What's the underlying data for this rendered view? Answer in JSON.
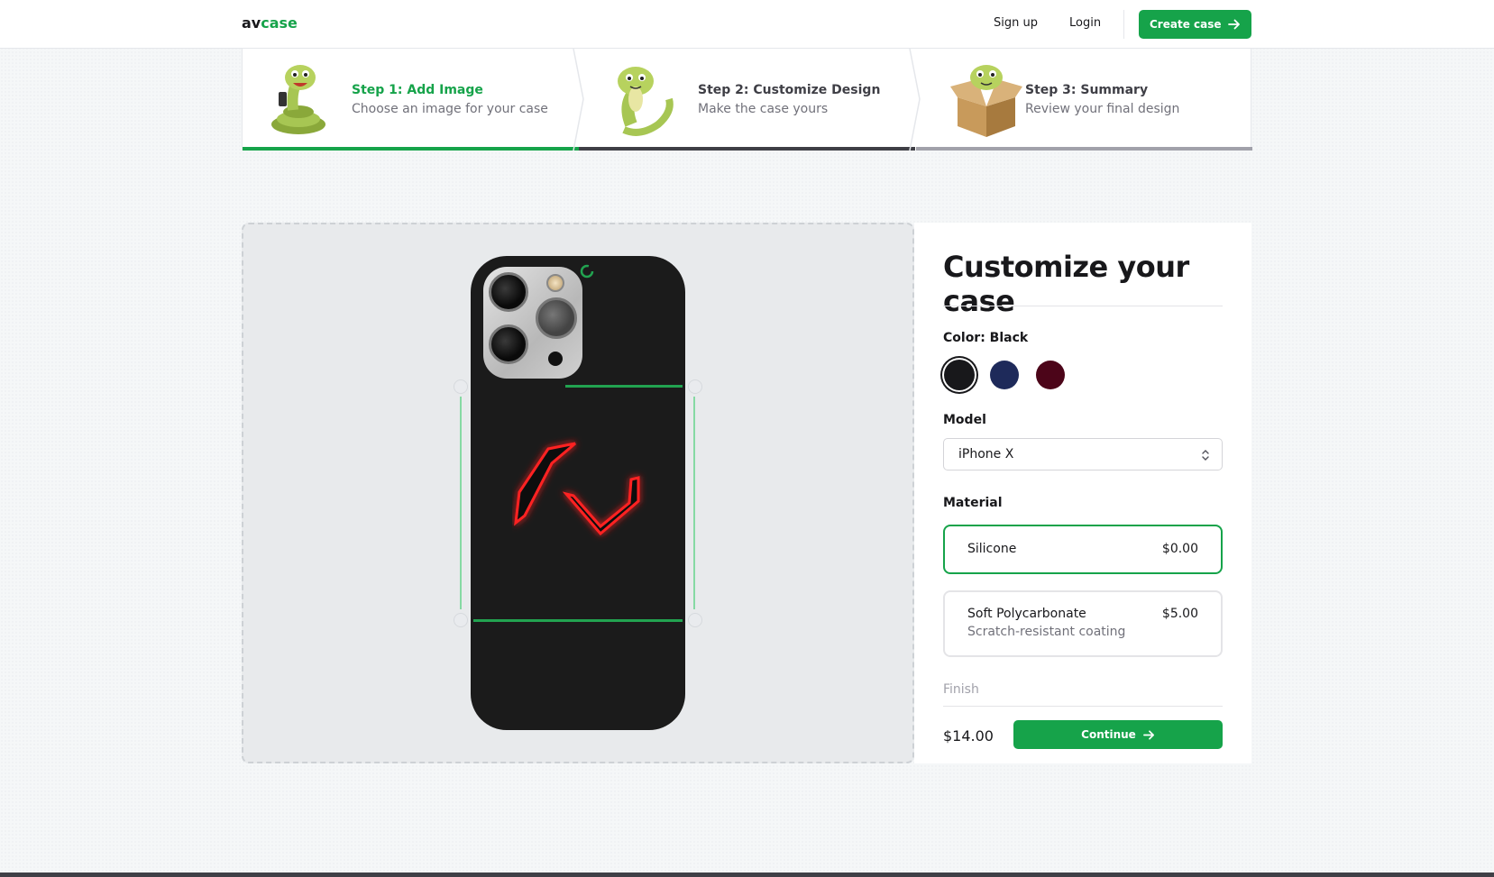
{
  "nav": {
    "logo_part1": "av",
    "logo_part2": "case",
    "signup": "Sign up",
    "login": "Login",
    "create_case": "Create case"
  },
  "steps": [
    {
      "title": "Step 1: Add Image",
      "subtitle": "Choose an image for your case",
      "status": "complete"
    },
    {
      "title": "Step 2: Customize Design",
      "subtitle": "Make the case yours",
      "status": "current"
    },
    {
      "title": "Step 3: Summary",
      "subtitle": "Review your final design",
      "status": "upcoming"
    }
  ],
  "panel": {
    "heading": "Customize your case",
    "color_label": "Color: Black",
    "colors": [
      {
        "name": "Black",
        "hex": "#18181b",
        "selected": true
      },
      {
        "name": "Blue",
        "hex": "#1e2a5a",
        "selected": false
      },
      {
        "name": "Rose",
        "hex": "#4c0519",
        "selected": false
      }
    ],
    "model_label": "Model",
    "model_value": "iPhone X",
    "material_label": "Material",
    "materials": [
      {
        "name": "Silicone",
        "price": "$0.00",
        "desc": "",
        "selected": true
      },
      {
        "name": "Soft Polycarbonate",
        "price": "$5.00",
        "desc": "Scratch-resistant coating",
        "selected": false
      }
    ],
    "finish_label": "Finish",
    "total": "$14.00",
    "continue": "Continue"
  },
  "colors": {
    "accent": "#16a34a",
    "current_step_bar": "#3f3f46",
    "upcoming_step_bar": "#a1a1aa"
  }
}
